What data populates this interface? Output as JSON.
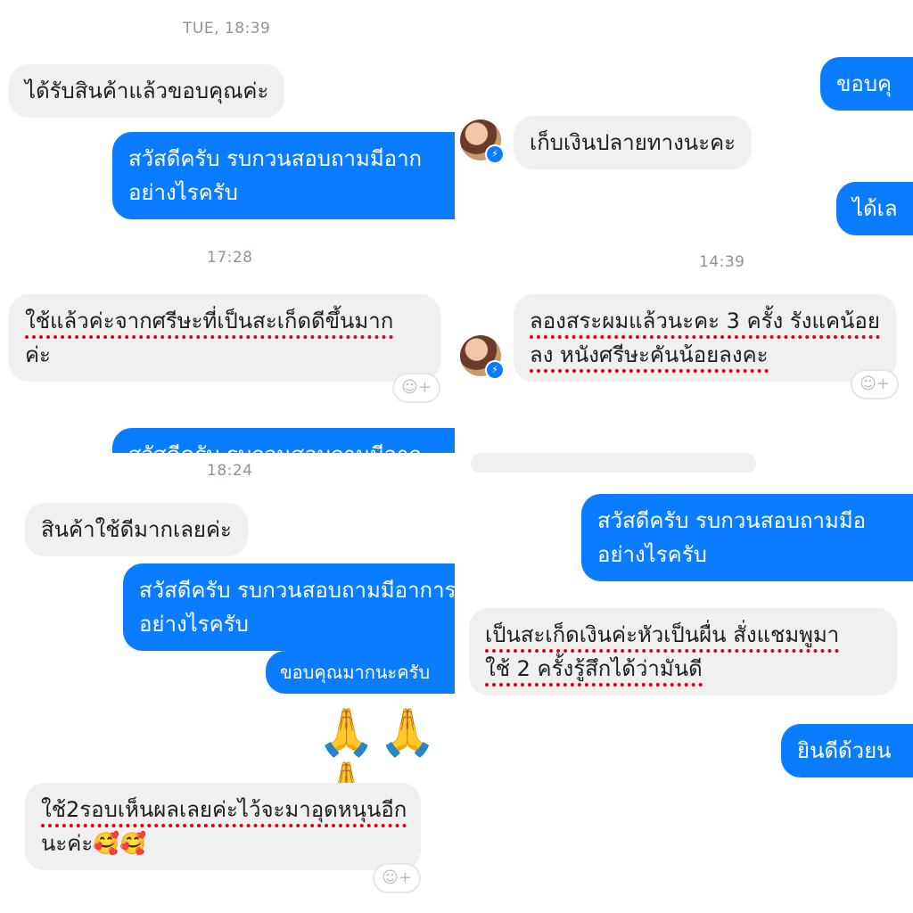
{
  "panel_top_left": {
    "timestamp_1": "TUE, 18:39",
    "msg_received_thanks": "ได้รับสินค้าแล้วขอบคุณค่ะ",
    "msg_greeting_line1": "สวัสดีครับ รบกวนสอบถามมีอาก",
    "msg_greeting_line2": "อย่างไรครับ",
    "timestamp_2": "17:28",
    "msg_review_line1": "ใช้แล้วค่ะจากศรีษะที่เป็นสะเก็ดดีขึ้นมาก",
    "msg_review_line2": "ค่ะ",
    "msg_greeting_cut": "สวัสดีครับ รบกวนสอบถามมีอาก",
    "reaction_icon": "☺+"
  },
  "panel_top_right": {
    "msg_out_thanks": "ขอบคุ",
    "msg_cod": "เก็บเงินปลายทางนะคะ",
    "msg_out_ok": "ได้เล",
    "timestamp": "14:39",
    "msg_review_line1": "ลองสระผมแล้วนะคะ 3 ครั้ง รังแคน้อย",
    "msg_review_line2": "ลง หนังศรีษะคันน้อยลงคะ",
    "reaction_icon": "☺+"
  },
  "panel_bottom_left": {
    "timestamp": "18:24",
    "msg_product_good": "สินค้าใช้ดีมากเลยค่ะ",
    "msg_greeting_line1": "สวัสดีครับ รบกวนสอบถามมีอาการ",
    "msg_greeting_line2": "อย่างไรครับ",
    "msg_thanks": "ขอบคุณมากนะครับ",
    "hands_emoji": "🙏🙏🙏",
    "msg_review_line1": "ใช้2รอบเห็นผลเลยค่ะไว้จะมาอุดหนุนอีก",
    "msg_review_line2": "นะค่ะ🥰🥰",
    "reaction_icon": "☺+"
  },
  "panel_bottom_right": {
    "msg_greeting_line1": "สวัสดีครับ รบกวนสอบถามมีอ",
    "msg_greeting_line2": "อย่างไรครับ",
    "msg_review_line1": "เป็นสะเก็ดเงินค่ะหัวเป็นผื่น สั่งแชมพูมา",
    "msg_review_line2": "ใช้ 2 ครั้งรู้สึกได้ว่ามันดี",
    "msg_out_congrats": "ยินดีด้วยน"
  },
  "avatar_badge_icon": "messenger-icon",
  "colors": {
    "bubble_out": "#0a7cff",
    "bubble_in": "#f1f0f0",
    "highlight": "#e0001a",
    "timestamp": "#8d949e"
  }
}
